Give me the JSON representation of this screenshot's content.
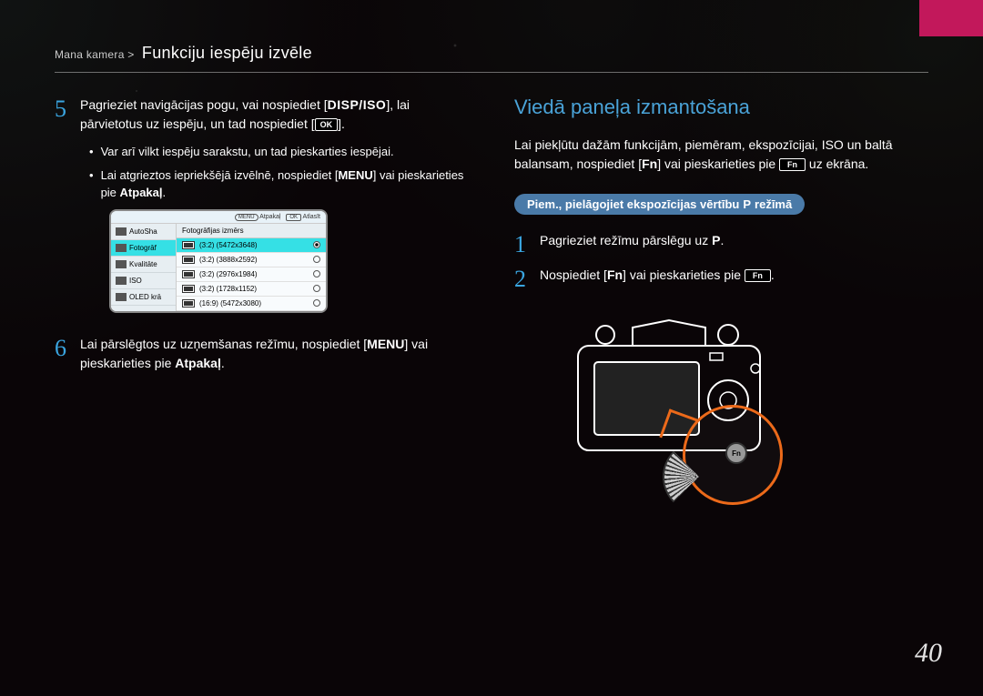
{
  "header": {
    "breadcrumb_pre": "Mana kamera >",
    "breadcrumb_title": "Funkciju iespēju izvēle"
  },
  "left_col": {
    "step5_num": "5",
    "step5_a": "Pagrieziet navigācijas pogu, vai nospiediet [",
    "step5_dispiso": "DISP/ISO",
    "step5_b": "], lai pārvietotus uz iespēju, un tad nospiediet [",
    "step5_ok_key": "OK",
    "step5_c": "].",
    "bullet1": "Var arī vilkt iespēju sarakstu, un tad pieskarties iespējai.",
    "bullet2_a": "Lai atgrieztos iepriekšējā izvēlnē, nospiediet [",
    "bullet2_menu": "MENU",
    "bullet2_b": "] vai pieskarieties pie ",
    "bullet2_bold": "Atpakaļ",
    "bullet2_c": ".",
    "lcd": {
      "top_left_label": "MENU",
      "top_back": "Atpakaļ",
      "top_ok": "OK",
      "top_select": "Atlasīt",
      "left_items": [
        "AutoSha",
        "Fotogrāf",
        "Kvalitāte",
        "ISO",
        "OLED krā"
      ],
      "left_selected_index": 1,
      "right_head": "Fotogrāfijas izmērs",
      "right_rows": [
        {
          "label": "(3:2) (5472x3648)",
          "sel": true
        },
        {
          "label": "(3:2) (3888x2592)",
          "sel": false
        },
        {
          "label": "(3:2) (2976x1984)",
          "sel": false
        },
        {
          "label": "(3:2) (1728x1152)",
          "sel": false
        },
        {
          "label": "(16:9) (5472x3080)",
          "sel": false
        }
      ]
    },
    "step6_num": "6",
    "step6_a": "Lai pārslēgtos uz uzņemšanas režīmu, nospiediet [",
    "step6_menu": "MENU",
    "step6_b": "] vai pieskarieties pie ",
    "step6_bold": "Atpakaļ",
    "step6_c": "."
  },
  "right_col": {
    "title": "Viedā paneļa izmantošana",
    "intro_a": "Lai piekļūtu dažām funkcijām, piemēram, ekspozīcijai, ISO un baltā balansam, nospiediet [",
    "intro_fn": "Fn",
    "intro_b": "] vai pieskarieties pie ",
    "intro_fn_btn": "Fn",
    "intro_c": " uz ekrāna.",
    "example_pill_a": "Piem., pielāgojiet ekspozīcijas vērtību ",
    "example_pill_mode": "P",
    "example_pill_b": " režīmā",
    "step1_num": "1",
    "step1_a": "Pagrieziet režīmu pārslēgu uz ",
    "step1_mode": "P",
    "step1_b": ".",
    "step2_num": "2",
    "step2_a": "Nospiediet [",
    "step2_fn": "Fn",
    "step2_b": "] vai pieskarieties pie ",
    "step2_fn_btn": "Fn",
    "step2_c": ".",
    "fn_label": "Fn"
  },
  "page_number": "40"
}
